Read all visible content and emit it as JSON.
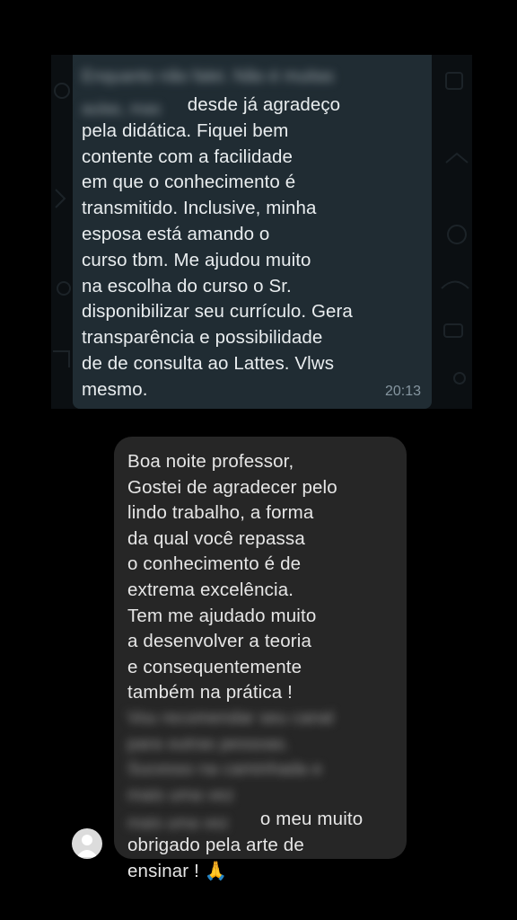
{
  "whatsapp_message": {
    "blurred_top": "Enquanto não falei. Não é muitas",
    "blurred_inline": "aulas, mas",
    "text_after_blur": " desde já agradeço\npela didática. Fiquei bem\ncontente com a facilidade\nem que o conhecimento é\ntransmitido. Inclusive, minha\nesposa está amando o\ncurso tbm. Me ajudou muito\nna escolha do curso o Sr.\ndisponibilizar seu currículo. Gera\ntransparência e possibilidade\nde de consulta ao Lattes. Vlws\nmesmo.",
    "time": "20:13"
  },
  "dm_message": {
    "text_visible": "Boa noite professor,\nGostei de agradecer pelo\nlindo trabalho, a forma\nda qual você repassa\no conhecimento é de\nextrema excelência.\nTem me ajudado muito\na desenvolver a teoria\ne consequentemente\ntambém na prática !",
    "blurred_block": "Vou recomendar seu canal\npara outras pessoas.\nSucesso na caminhada e\nmais uma vez",
    "text_after_blur": " o meu muito\nobrigado pela arte de\nensinar  ! ",
    "emoji": "🙏"
  },
  "colors": {
    "background": "#000000",
    "whatsapp_bubble": "#202c33",
    "dm_bubble": "#262626",
    "text": "#e9edef",
    "timestamp": "#8696a0"
  },
  "icons": [
    "avatar-placeholder-icon",
    "folded-hands-emoji"
  ]
}
